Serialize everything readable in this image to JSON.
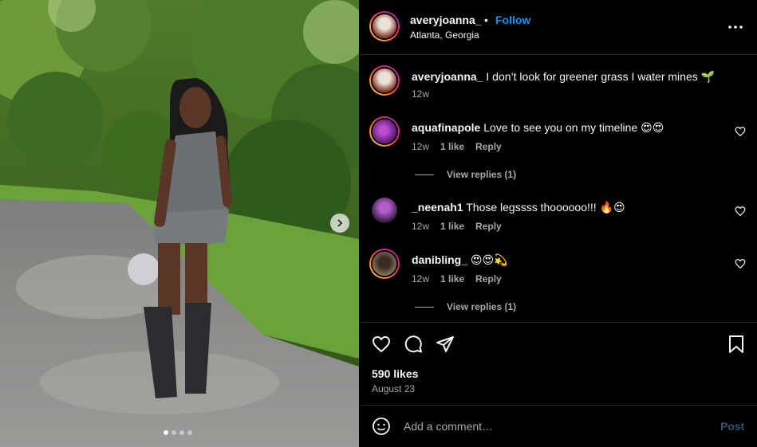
{
  "post": {
    "username": "averyjoanna_",
    "separator": "•",
    "follow_label": "Follow",
    "location": "Atlanta, Georgia",
    "more_icon": "more-horizontal-icon"
  },
  "caption": {
    "username": "averyjoanna_",
    "text": "I don’t look for greener grass I water mines 🌱",
    "time": "12w"
  },
  "comments": [
    {
      "username": "aquafinapole",
      "text": "Love to see you on my timeline 😍😍",
      "time": "12w",
      "likes": "1 like",
      "reply_label": "Reply",
      "view_replies": "View replies (1)"
    },
    {
      "username": "_neenah1",
      "text": "Those legssss thoooooo!!! 🔥😍",
      "time": "12w",
      "likes": "1 like",
      "reply_label": "Reply"
    },
    {
      "username": "danibling_",
      "text": "😍😍💫",
      "time": "12w",
      "likes": "1 like",
      "reply_label": "Reply",
      "view_replies": "View replies (1)"
    }
  ],
  "actions": {
    "likes": "590 likes",
    "date": "August 23",
    "icons": [
      "heart-icon",
      "comment-icon",
      "share-icon",
      "bookmark-icon"
    ]
  },
  "comment_box": {
    "placeholder": "Add a comment…",
    "post_label": "Post"
  },
  "carousel": {
    "slide_count": 4,
    "active_slide": 1
  },
  "colors": {
    "background": "#000000",
    "link_blue": "#0095f6",
    "muted": "#a8a8a8",
    "divider": "#262626",
    "post_disabled": "#30546e"
  }
}
